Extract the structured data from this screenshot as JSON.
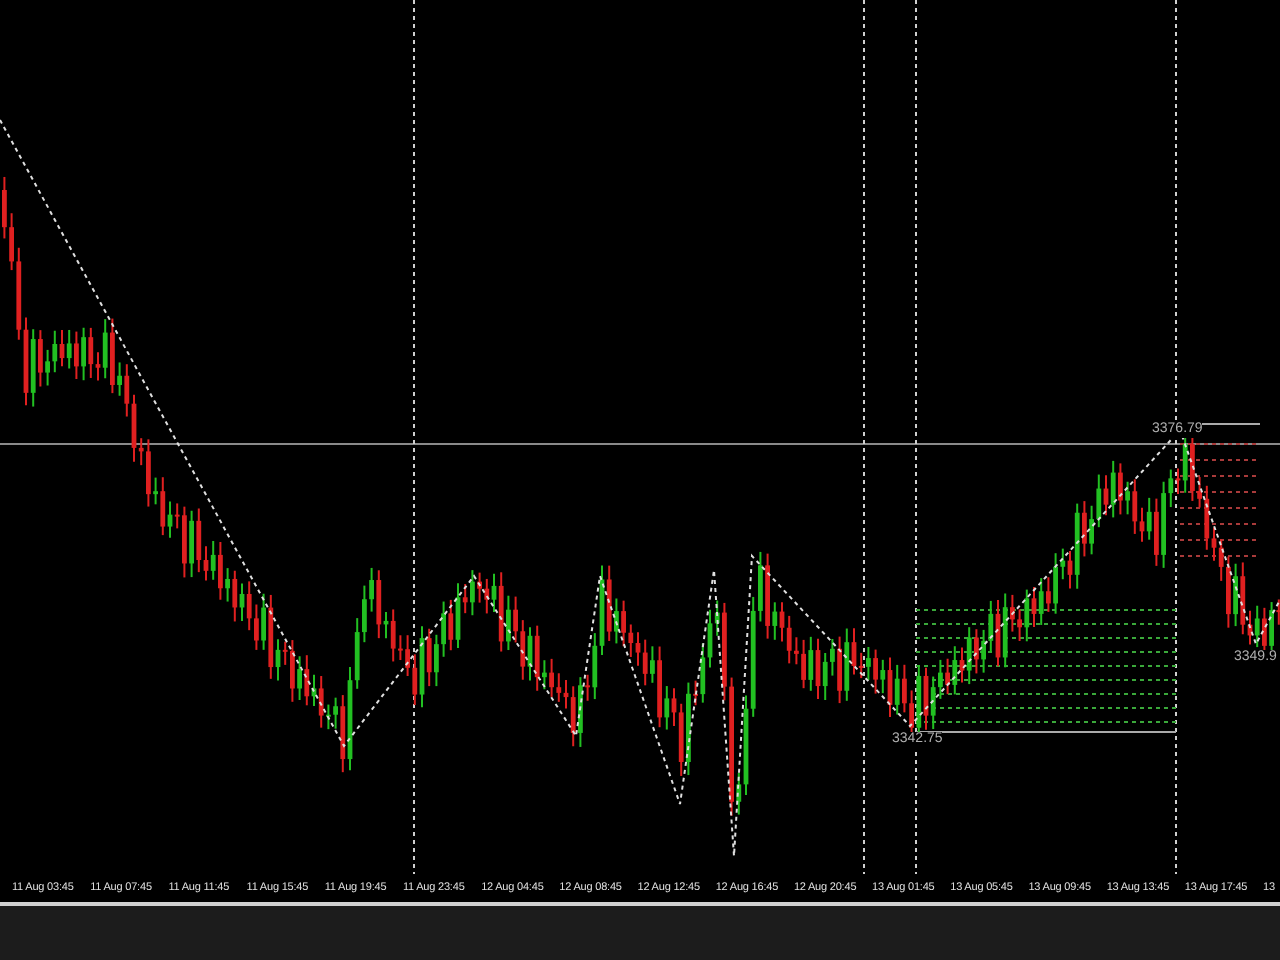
{
  "chart": {
    "price_labels": [
      {
        "kind": "high",
        "text": "3376.79"
      },
      {
        "kind": "low",
        "text": "3342.75"
      },
      {
        "kind": "last",
        "text": "3349.9"
      }
    ]
  },
  "time_axis": {
    "labels": [
      "11 Aug 03:45",
      "11 Aug 07:45",
      "11 Aug 11:45",
      "11 Aug 15:45",
      "11 Aug 19:45",
      "11 Aug 23:45",
      "12 Aug 04:45",
      "12 Aug 08:45",
      "12 Aug 12:45",
      "12 Aug 16:45",
      "12 Aug 20:45",
      "13 Aug 01:45",
      "13 Aug 05:45",
      "13 Aug 09:45",
      "13 Aug 13:45",
      "13 Aug 17:45",
      "13"
    ]
  }
}
